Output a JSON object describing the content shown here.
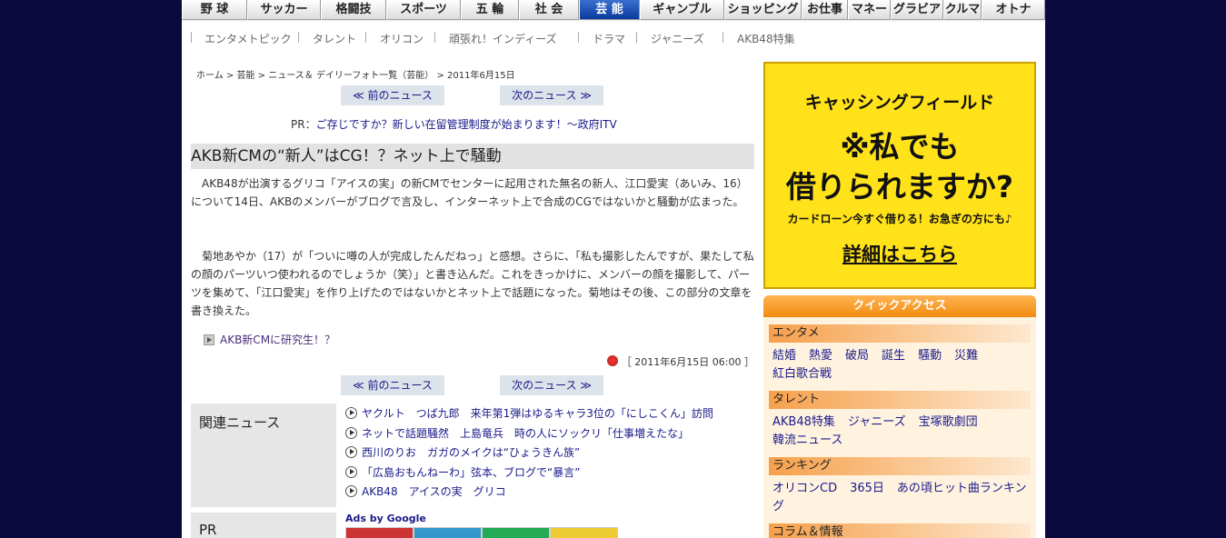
{
  "topnav": [
    "野 球",
    "サッカー",
    "格闘技",
    "スポーツ",
    "五 輪",
    "社 会",
    "芸 能",
    "ギャンブル",
    "ショッピング",
    "お仕事",
    "マネー",
    "グラビア",
    "クルマ",
    "オトナ"
  ],
  "subnav": [
    "エンタメトピック",
    "タレント",
    "オリコン",
    "頑張れ！インディーズ",
    "ドラマ",
    "ジャニーズ",
    "AKB48特集"
  ],
  "breadcrumb": {
    "home": "ホーム",
    "sep": " > ",
    "geino": "芸能",
    "list": "ニュース＆ デイリーフォト一覧（芸能）",
    "date": "2011年6月15日"
  },
  "nav": {
    "prev": "≪ 前のニュース",
    "next": "次のニュース ≫"
  },
  "pr": {
    "prefix": "PR：",
    "link": "ご存じですか？新しい在留管理制度が始まります！～政府ITV"
  },
  "article": {
    "headline": "AKB新CMの“新人”はCG！？ネット上で騒動",
    "p1": "　AKB48が出演するグリコ「アイスの実」の新CMでセンターに起用された無名の新人、江口愛実（あいみ、16）について14日、AKBのメンバーがブログで言及し、インターネット上で合成のCGではないかと騒動が広まった。",
    "p2": "　菊地あやか（17）が「ついに噂の人が完成したんだねっ」と感想。さらに、「私も撮影したんですが、果たして私の顔のパーツいつ使われるのでしょうか（笑）」と書き込んだ。これをきっかけに、メンバーの顔を撮影して、パーツを集めて、「江口愛実」を作り上げたのではないかとネット上で話題になった。菊地はその後、この部分の文章を書き換えた。",
    "related_link": "AKB新CMに研究生！？",
    "timestamp": "［ 2011年6月15日 06:00 ］"
  },
  "related": {
    "heading": "関連ニュース",
    "items": [
      "ヤクルト　つば九郎　来年第1弾はゆるキャラ3位の「にしこくん」訪問",
      "ネットで話題騒然　上島竜兵　時の人にソックリ「仕事増えたな」",
      "西川のりお　ガガのメイクは“ひょうきん族”",
      "「広島おもんねーわ」弦本、ブログで“暴言”",
      "AKB48　アイスの実　グリコ"
    ]
  },
  "pr_heading": "PR",
  "ads_label": "Ads by Google",
  "banner": {
    "line1": "キャッシングフィールド",
    "line2": "※私でも",
    "line3": "借りられますか?",
    "line4": "カードローン今すぐ借りる！お急ぎの方にも♪",
    "line5": "詳細はこちら"
  },
  "quick_access": {
    "title": "クイックアクセス",
    "sections": [
      {
        "label": "エンタメ",
        "links": [
          "結婚",
          "熱愛",
          "破局",
          "誕生",
          "騒動",
          "災難",
          "紅白歌合戦"
        ]
      },
      {
        "label": "タレント",
        "links": [
          "AKB48特集",
          "ジャニーズ",
          "宝塚歌劇団",
          "韓流ニュース"
        ]
      },
      {
        "label": "ランキング",
        "links": [
          "オリコンCD",
          "365日",
          "あの頃ヒット曲ランキング"
        ]
      },
      {
        "label": "コラム＆情報",
        "links": []
      }
    ]
  },
  "colors": {
    "background": "#0a0a3e",
    "nav_active": "#0a3a9e",
    "link": "#1a1a8a",
    "accent_orange": "#f28c10",
    "banner_yellow": "#ffe21a"
  }
}
